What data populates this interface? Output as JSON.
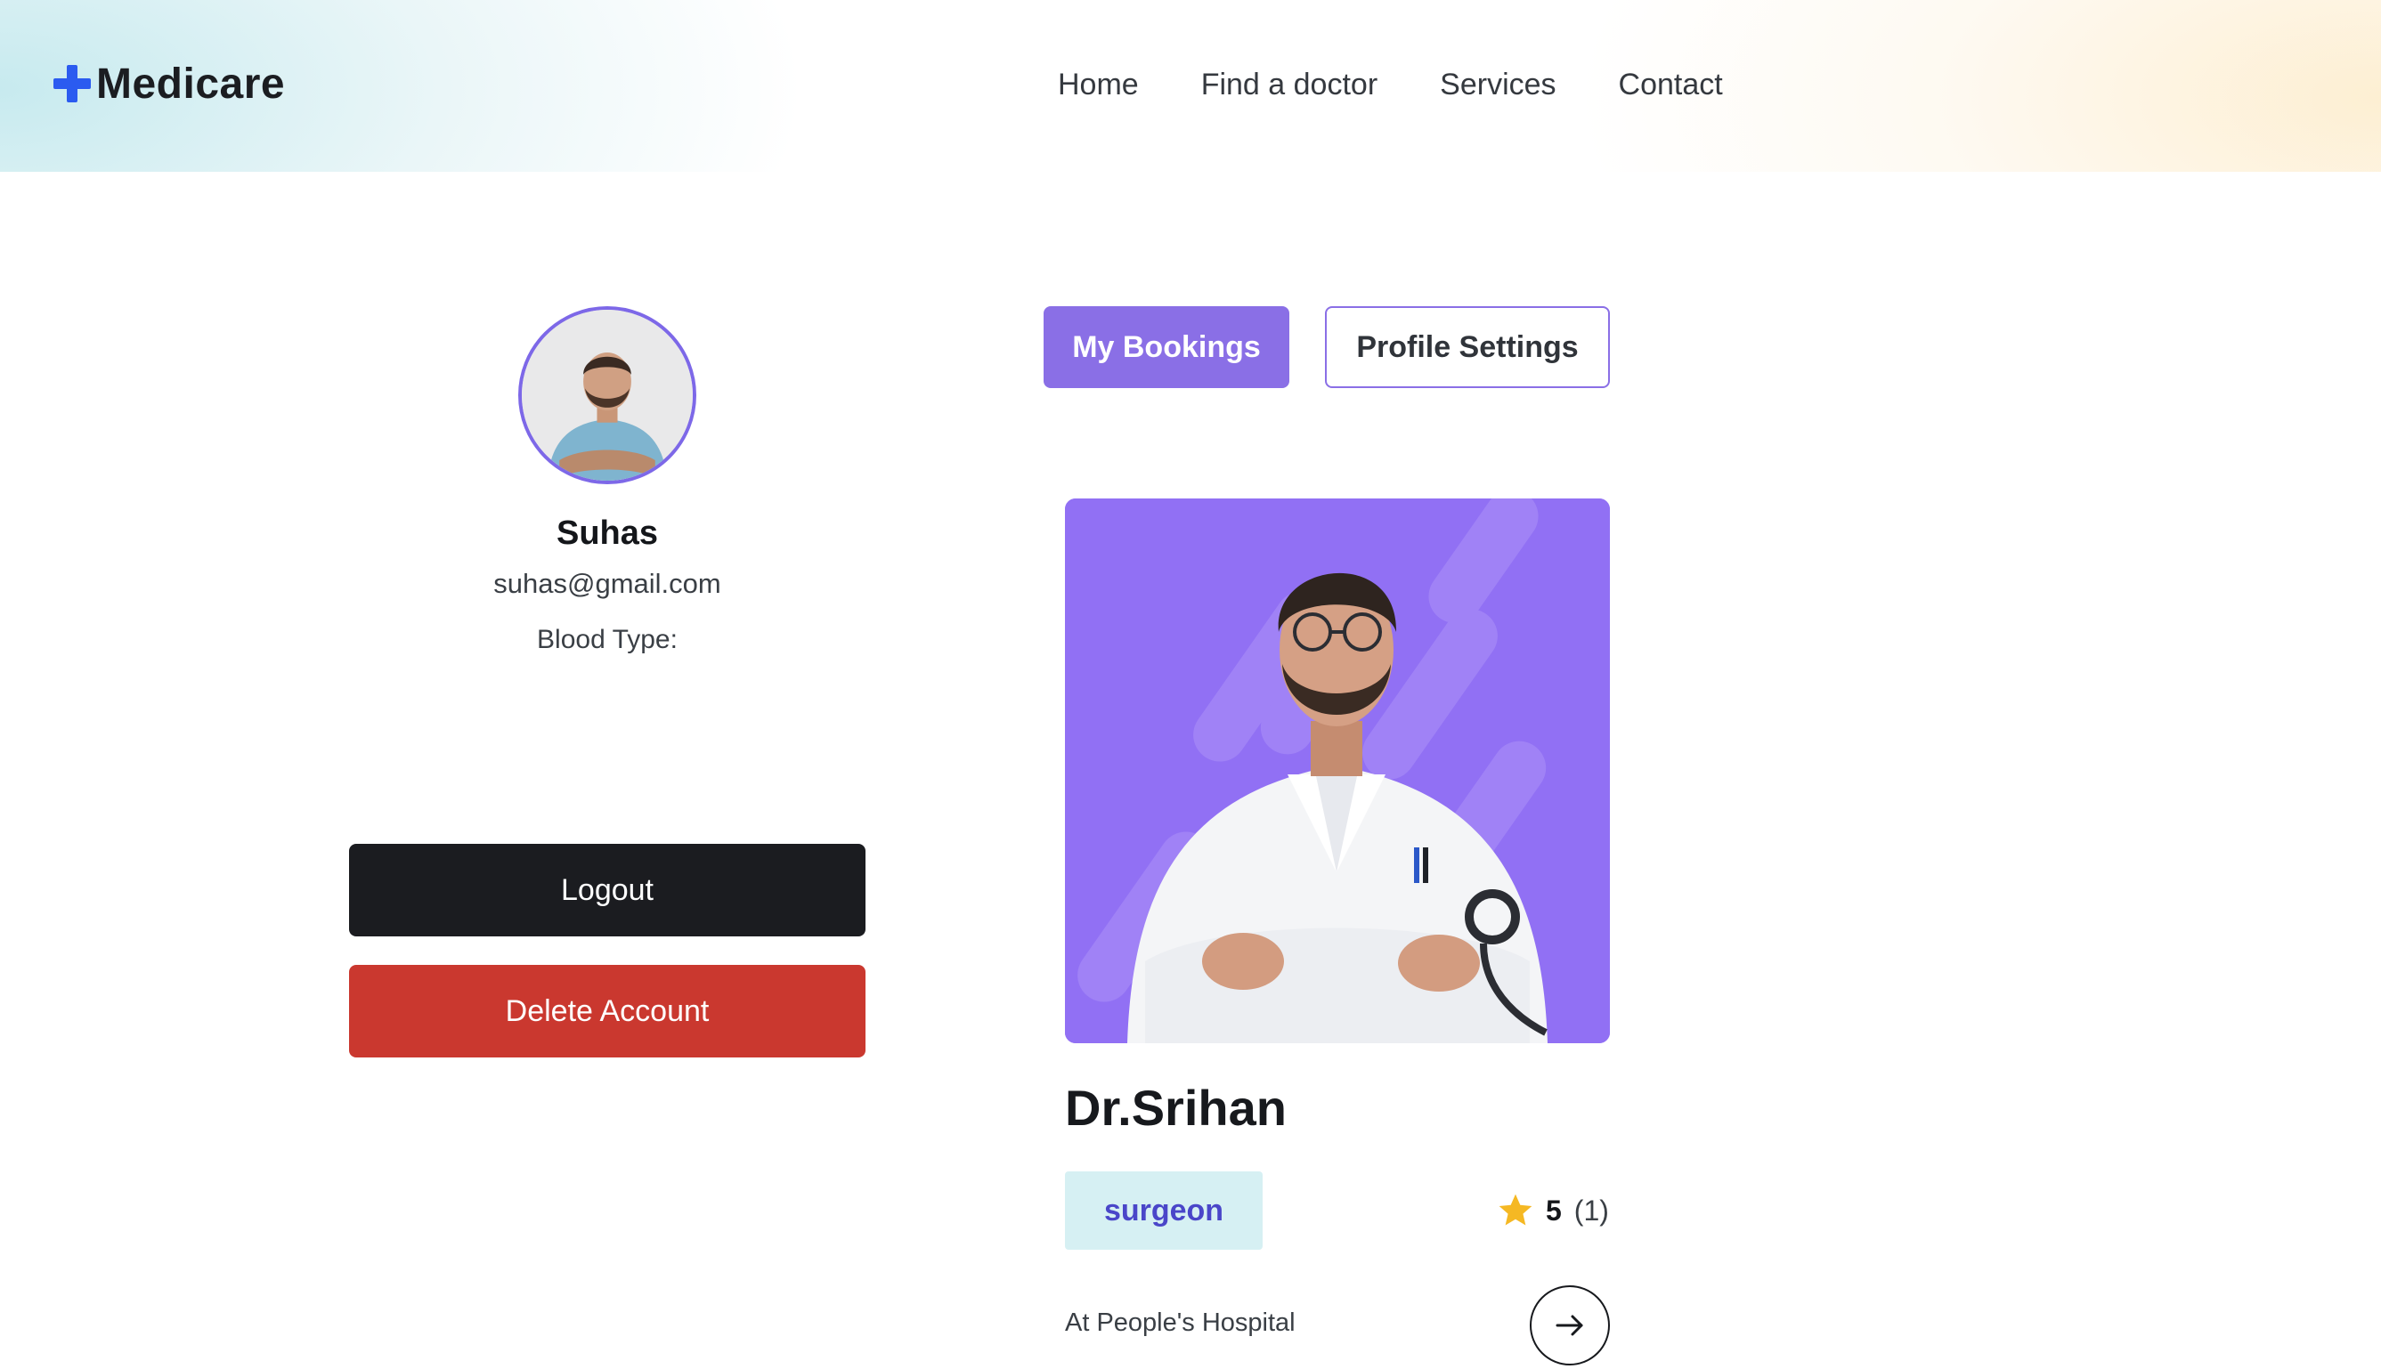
{
  "header": {
    "logo_text": "Medicare",
    "logo_icon": "plus-cross-icon",
    "nav": [
      {
        "label": "Home"
      },
      {
        "label": "Find a doctor"
      },
      {
        "label": "Services"
      },
      {
        "label": "Contact"
      }
    ]
  },
  "profile": {
    "name": "Suhas",
    "email": "suhas@gmail.com",
    "blood_type_label": "Blood Type:",
    "logout_label": "Logout",
    "delete_label": "Delete Account"
  },
  "tabs": {
    "bookings_label": "My Bookings",
    "settings_label": "Profile Settings"
  },
  "booking": {
    "doctor_name": "Dr.Srihan",
    "specialty": "surgeon",
    "rating": "5",
    "rating_count": "(1)",
    "hospital": "At People's Hospital"
  },
  "colors": {
    "brand_accent": "#8a6fe6",
    "logo_cross": "#2b5bf0",
    "logout_bg": "#1b1c20",
    "delete_bg": "#ca382f",
    "badge_bg": "#d6f0f3",
    "badge_text": "#4a46c9",
    "star": "#f5b823",
    "doctor_photo_bg": "#9170f4"
  }
}
